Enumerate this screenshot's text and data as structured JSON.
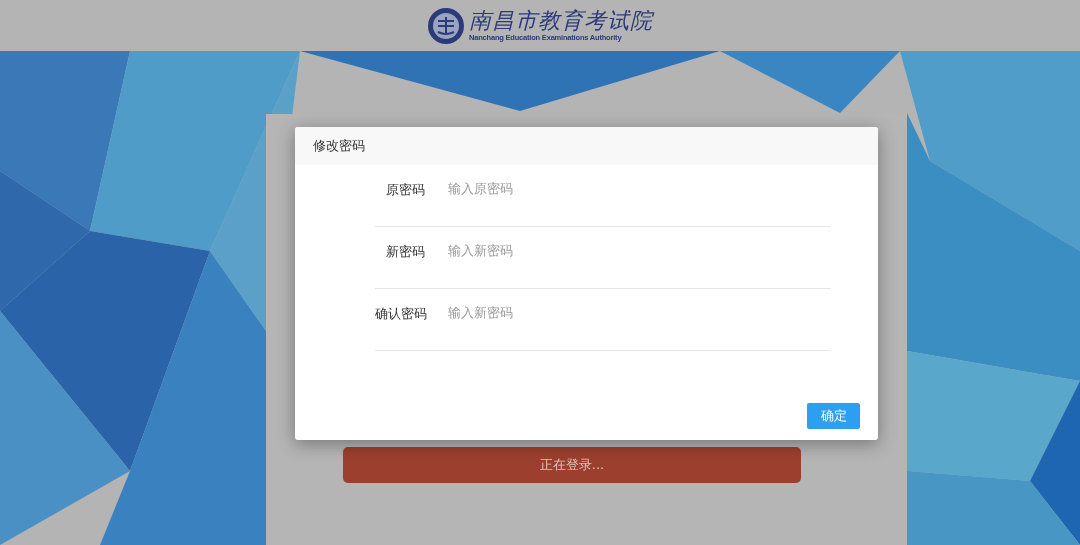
{
  "header": {
    "logo_title": "南昌市教育考试院",
    "logo_subtitle": "Nanchang Education Examinations Authority"
  },
  "login": {
    "button": "正在登录..."
  },
  "dialog": {
    "title": "修改密码",
    "fields": [
      {
        "label": "原密码",
        "placeholder": "输入原密码"
      },
      {
        "label": "新密码",
        "placeholder": "输入新密码"
      },
      {
        "label": "确认密码",
        "placeholder": "输入新密码"
      }
    ],
    "confirm": "确定"
  }
}
